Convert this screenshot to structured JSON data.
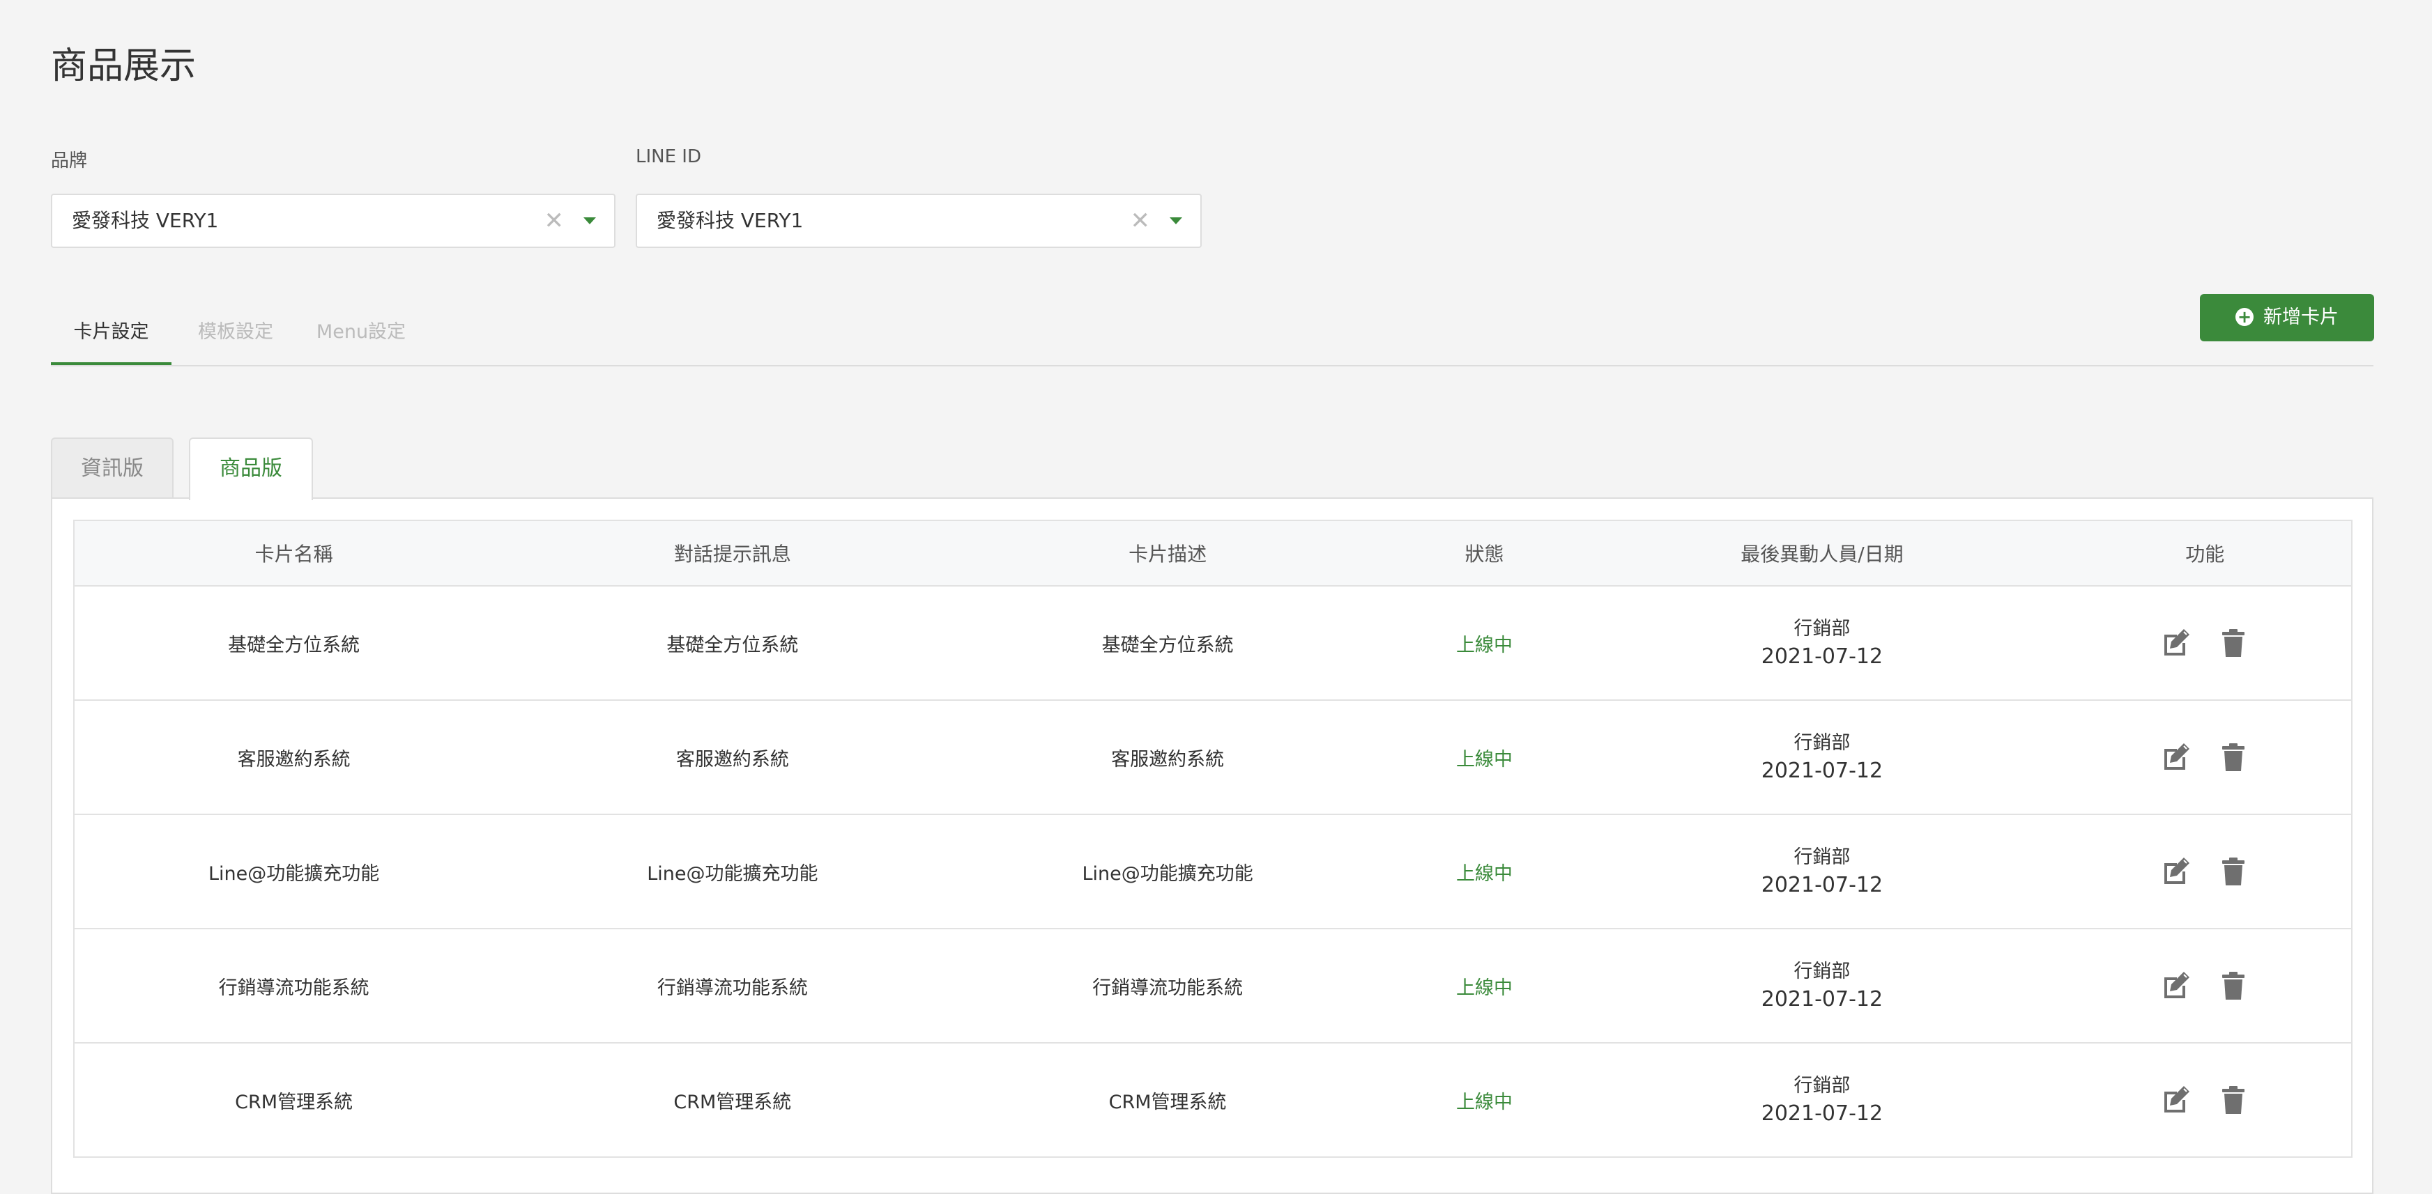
{
  "page": {
    "title": "商品展示"
  },
  "filters": {
    "brand_label": "品牌",
    "brand_value": "愛發科技 VERY1",
    "line_label": "LINE ID",
    "line_value": "愛發科技 VERY1",
    "clear_symbol": "✕"
  },
  "nav_tabs": [
    {
      "label": "卡片設定",
      "active": true
    },
    {
      "label": "模板設定",
      "active": false
    },
    {
      "label": "Menu設定",
      "active": false
    }
  ],
  "add_button": {
    "label": "新增卡片",
    "icon": "plus-circle-icon"
  },
  "card_tabs": [
    {
      "label": "資訊版",
      "active": false
    },
    {
      "label": "商品版",
      "active": true
    }
  ],
  "table": {
    "headers": [
      "卡片名稱",
      "對話提示訊息",
      "卡片描述",
      "狀態",
      "最後異動人員/日期",
      "功能"
    ],
    "rows": [
      {
        "name": "基礎全方位系統",
        "prompt": "基礎全方位系統",
        "desc": "基礎全方位系統",
        "status": "上線中",
        "editor": "行銷部",
        "date": "2021-07-12"
      },
      {
        "name": "客服邀約系統",
        "prompt": "客服邀約系統",
        "desc": "客服邀約系統",
        "status": "上線中",
        "editor": "行銷部",
        "date": "2021-07-12"
      },
      {
        "name": "Line@功能擴充功能",
        "prompt": "Line@功能擴充功能",
        "desc": "Line@功能擴充功能",
        "status": "上線中",
        "editor": "行銷部",
        "date": "2021-07-12"
      },
      {
        "name": "行銷導流功能系統",
        "prompt": "行銷導流功能系統",
        "desc": "行銷導流功能系統",
        "status": "上線中",
        "editor": "行銷部",
        "date": "2021-07-12"
      },
      {
        "name": "CRM管理系統",
        "prompt": "CRM管理系統",
        "desc": "CRM管理系統",
        "status": "上線中",
        "editor": "行銷部",
        "date": "2021-07-12"
      }
    ]
  },
  "colors": {
    "accent": "#3b8a3b",
    "status_online": "#3a8a3a",
    "icon_gray": "#6f6f6f"
  }
}
